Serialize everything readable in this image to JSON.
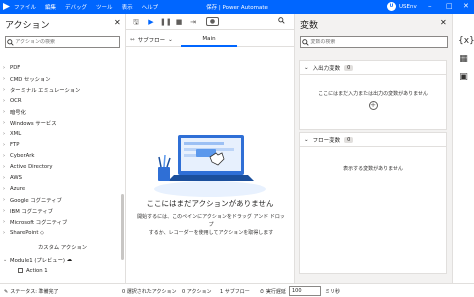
{
  "titlebar": {
    "menu": [
      "ファイル",
      "編集",
      "デバッグ",
      "ツール",
      "表示",
      "ヘルプ"
    ],
    "window_title": "保存 | Power Automate",
    "user": "USEnv",
    "avatar": "U",
    "accent": "#0066ff"
  },
  "left_panel": {
    "title": "アクション",
    "search_placeholder": "アクションの検索",
    "items": [
      "PDF",
      "CMD セッション",
      "ターミナル エミュレーション",
      "OCR",
      "暗号化",
      "Windows サービス",
      "XML",
      "FTP",
      "CyberArk",
      "Active Directory",
      "AWS",
      "Azure",
      "Google コグニティブ",
      "IBM コグニティブ",
      "Microsoft コグニティブ",
      "SharePoint"
    ],
    "custom_header": "カスタム アクション",
    "module_label": "Module1 (プレビュー)",
    "action_label": "Action 1"
  },
  "center": {
    "subflow_label": "サブフロー",
    "tab_main": "Main",
    "empty_title": "ここにはまだアクションがありません",
    "empty_desc_line1": "開始するには、このペインにアクションをドラッグ アンド ドロップ",
    "empty_desc_line2": "するか、レコーダーを使用してアクションを取得します"
  },
  "right_panel": {
    "title": "変数",
    "search_placeholder": "変数の検索",
    "io_section": {
      "title": "入出力変数",
      "count": "0",
      "empty": "ここにはまだ入力または出力の変数がありません"
    },
    "flow_section": {
      "title": "フロー変数",
      "count": "0",
      "empty": "表示する変数がありません"
    }
  },
  "status": {
    "state": "ステータス: 準備完了",
    "selected": "0 選択されたアクション",
    "actions": "0 アクション",
    "subflows": "1 サブフロー",
    "run_delay_label": "実行遅延",
    "run_delay_value": "100",
    "unit": "ミリ秒"
  }
}
